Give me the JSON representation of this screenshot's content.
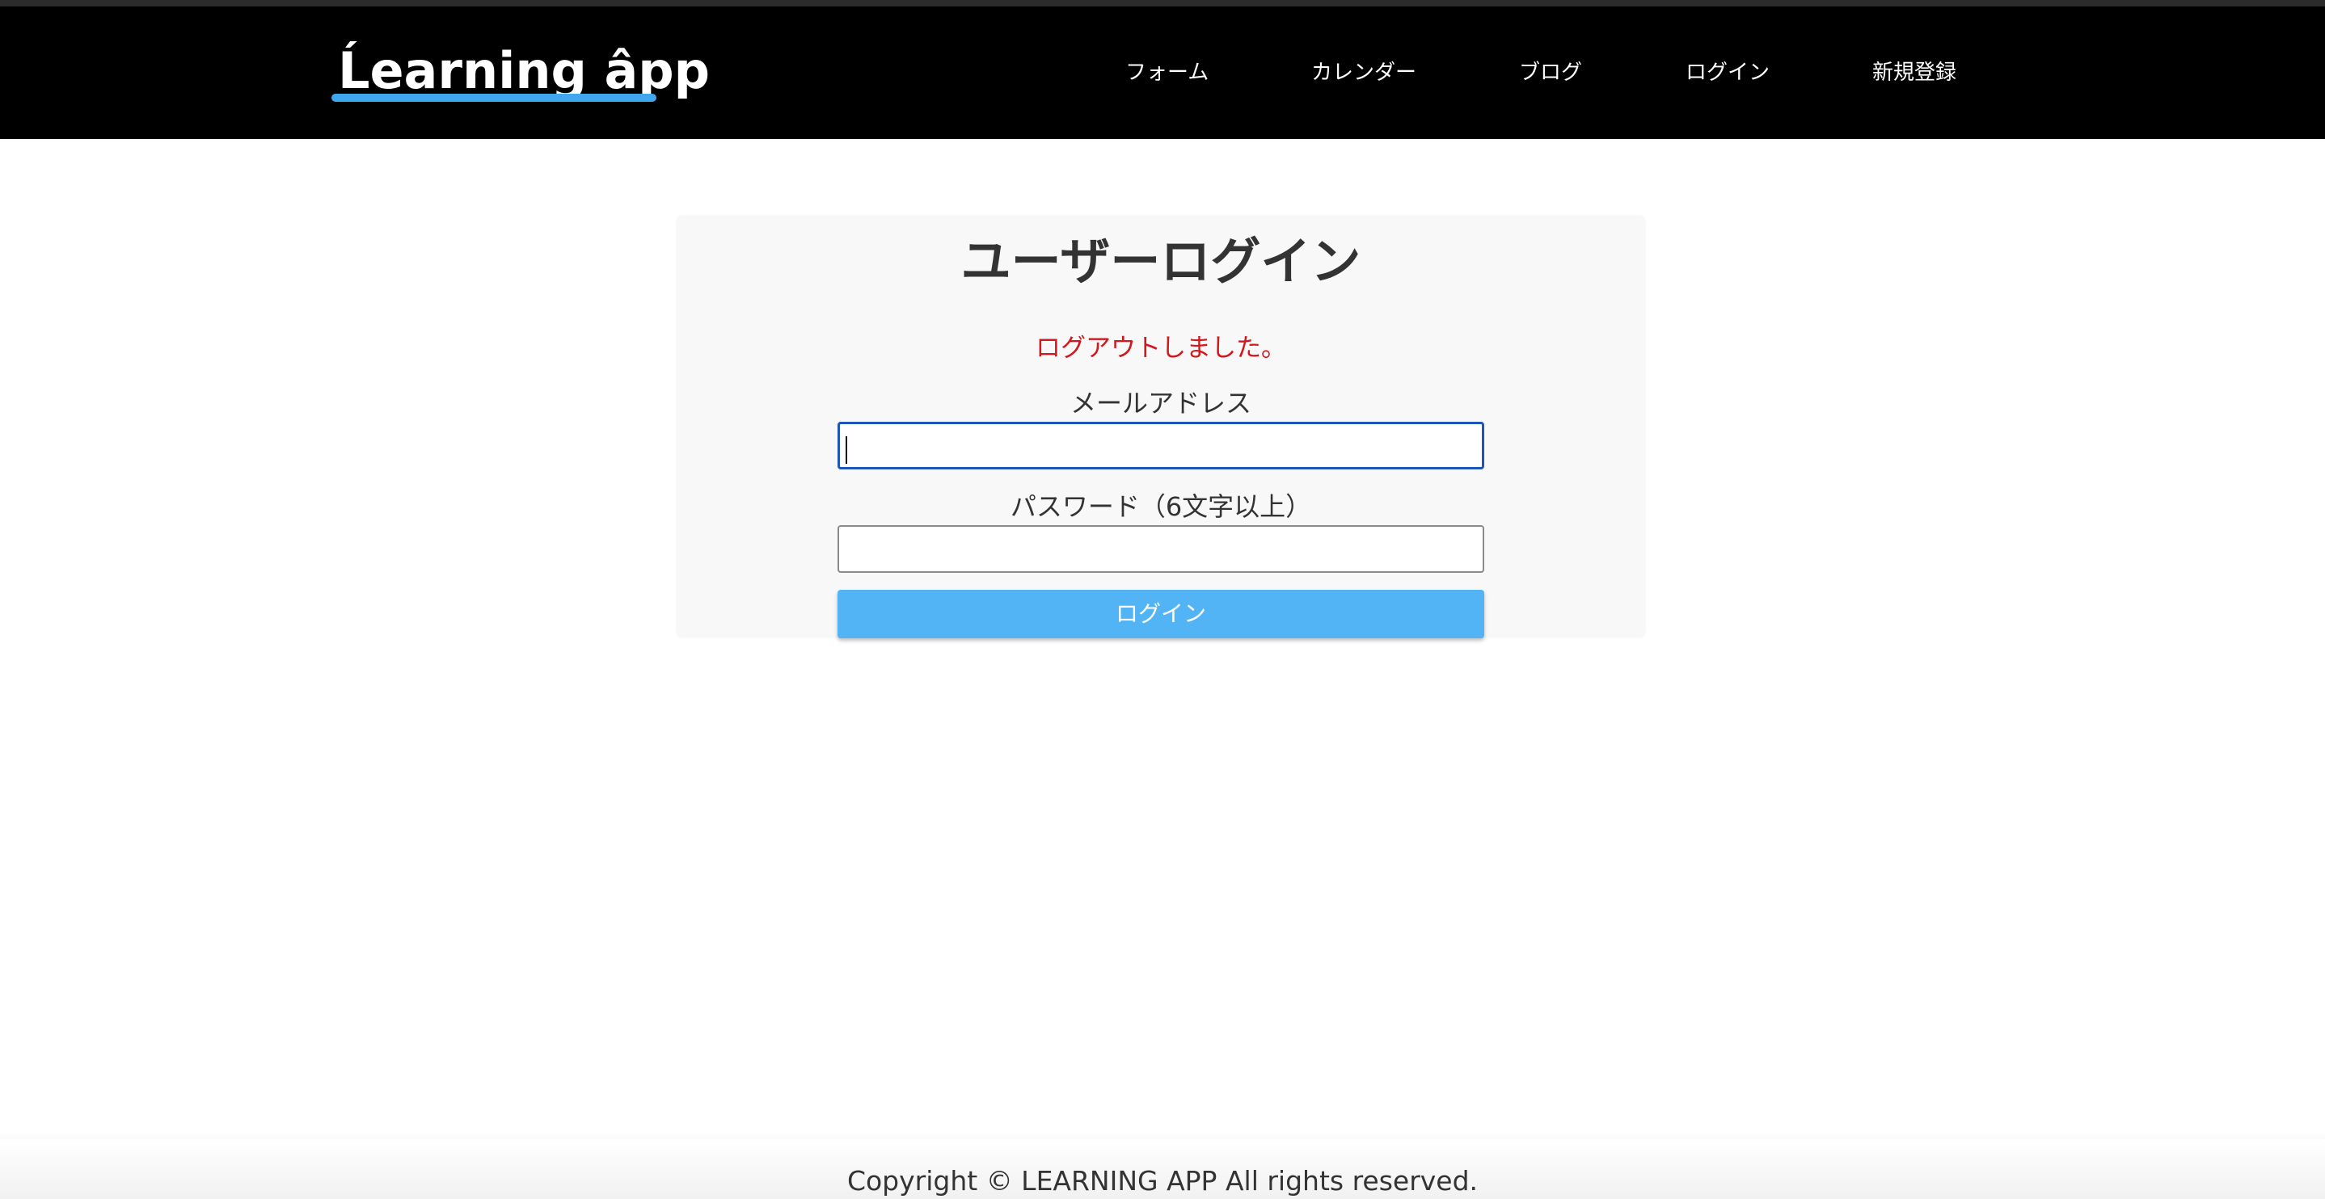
{
  "header": {
    "logo_text": "Ĺearning âpp",
    "nav": [
      {
        "label": "フォーム"
      },
      {
        "label": "カレンダー"
      },
      {
        "label": "ブログ"
      },
      {
        "label": "ログイン"
      },
      {
        "label": "新規登録"
      }
    ]
  },
  "login": {
    "title": "ユーザーログイン",
    "flash_message": "ログアウトしました。",
    "email_label": "メールアドレス",
    "email_value": "",
    "password_label": "パスワード（6文字以上）",
    "password_value": "",
    "submit_label": "ログイン"
  },
  "footer": {
    "copyright": "Copyright © LEARNING APP All rights reserved."
  },
  "colors": {
    "header_bg": "#000000",
    "accent": "#52b4f5",
    "flash": "#d0191f",
    "focus_border": "#1d56b8"
  }
}
